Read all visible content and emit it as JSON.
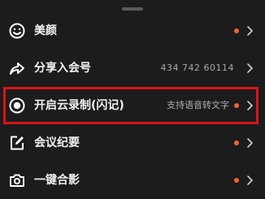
{
  "menu": {
    "items": [
      {
        "id": "beauty",
        "label": "美颜",
        "icon": "smile-icon",
        "has_dot": true
      },
      {
        "id": "share",
        "label": "分享入会号",
        "value": "434 742 60114",
        "icon": "share-arrow-icon",
        "has_dot": false
      },
      {
        "id": "cloud_record",
        "label": "开启云录制(闪记)",
        "sub": "支持语音转文字",
        "icon": "record-icon",
        "has_dot": true,
        "highlighted": true
      },
      {
        "id": "minutes",
        "label": "会议纪要",
        "icon": "edit-note-icon",
        "has_dot": true
      },
      {
        "id": "photo",
        "label": "一键合影",
        "icon": "camera-icon",
        "has_dot": true
      }
    ]
  },
  "colors": {
    "background": "#1c1c1c",
    "dot": "#f0642e",
    "highlight_border": "#d9141b"
  }
}
